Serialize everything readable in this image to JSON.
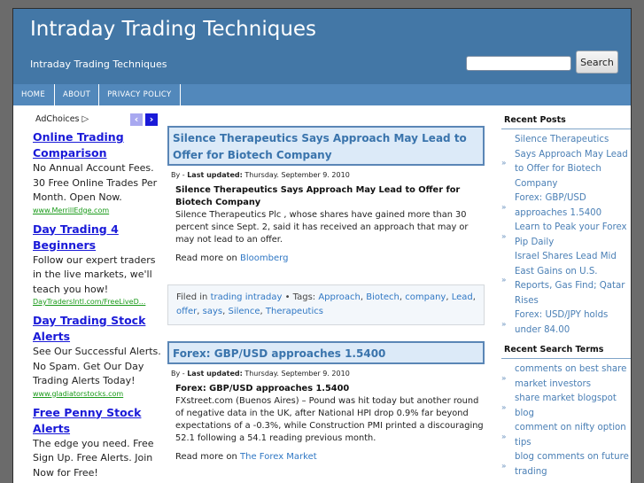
{
  "header": {
    "site_title": "Intraday Trading Techniques",
    "site_description": "Intraday Trading Techniques",
    "search": {
      "value": "",
      "placeholder": "",
      "button_label": "Search"
    }
  },
  "nav": {
    "items": [
      {
        "label": "HOME"
      },
      {
        "label": "ABOUT"
      },
      {
        "label": "PRIVACY POLICY"
      }
    ]
  },
  "ads": {
    "adchoices_label": "AdChoices",
    "adchoices_icon": "▷",
    "prev_icon": "‹",
    "next_icon": "›",
    "items": [
      {
        "title": "Online Trading Comparison",
        "text": "No Annual Account Fees. 30 Free Online Trades Per Month. Open Now.",
        "url": "www.MerrillEdge.com"
      },
      {
        "title": "Day Trading 4 Beginners",
        "text": "Follow our expert traders in the live markets, we'll teach you how!",
        "url": "DayTradersIntl.com/FreeLiveD..."
      },
      {
        "title": "Day Trading Stock Alerts",
        "text": "See Our Successful Alerts. No Spam. Get Our Day Trading Alerts Today!",
        "url": "www.gladiatorstocks.com"
      },
      {
        "title": "Free Penny Stock Alerts",
        "text": "The edge you need. Free Sign Up. Free Alerts. Join Now for Free!",
        "url": ""
      }
    ]
  },
  "posts": [
    {
      "title": "Silence Therapeutics Says Approach May Lead to Offer for Biotech Company",
      "meta_prefix": "By - ",
      "meta_label": "Last updated:",
      "meta_date": " Thursday. September 9. 2010",
      "body_title": "Silence Therapeutics Says Approach May Lead to Offer for Biotech Company",
      "body_text": "Silence Therapeutics Plc , whose shares have gained more than 30 percent since Sept. 2, said it has received an approach that may or may not lead to an offer.",
      "readmore_prefix": "Read more on ",
      "readmore_source": "Bloomberg",
      "filed_prefix": "Filed in ",
      "category": "trading intraday",
      "tags_prefix": " • Tags: ",
      "tags": [
        "Approach",
        "Biotech",
        "company",
        "Lead",
        "offer",
        "says",
        "Silence",
        "Therapeutics"
      ]
    },
    {
      "title": "Forex: GBP/USD approaches 1.5400",
      "meta_prefix": "By - ",
      "meta_label": "Last updated:",
      "meta_date": " Thursday. September 9. 2010",
      "body_title": "Forex: GBP/USD approaches 1.5400",
      "body_text": "FXstreet.com (Buenos Aires) – Pound was hit today but another round of negative data in the UK, after National HPI drop 0.9% far beyond expectations of a -0.3%, while Construction PMI printed a discouraging 52.1 following a 54.1 reading previous month.",
      "readmore_prefix": "Read more on ",
      "readmore_source": "The Forex Market"
    }
  ],
  "sidebar": {
    "recent_posts": {
      "title": "Recent Posts",
      "items": [
        "Silence Therapeutics Says Approach May Lead to Offer for Biotech Company",
        "Forex: GBP/USD approaches 1.5400",
        "Learn to Peak your Forex Pip Daily",
        "Israel Shares Lead Mid East Gains on U.S. Reports, Gas Find; Qatar Rises",
        "Forex: USD/JPY holds under 84.00"
      ]
    },
    "recent_search_terms": {
      "title": "Recent Search Terms",
      "items": [
        "comments on best share market investors",
        "share market blogspot blog",
        "comment on nifty option tips",
        "blog comments on future trading"
      ]
    },
    "bullet_icon": "»"
  },
  "colors": {
    "header_bg": "#4377a6",
    "nav_bg": "#5288bb",
    "post_title": "#3a74ac",
    "link": "#2f77c4",
    "ad_title": "#1a1ad8",
    "ad_url": "#1a9a1a"
  }
}
